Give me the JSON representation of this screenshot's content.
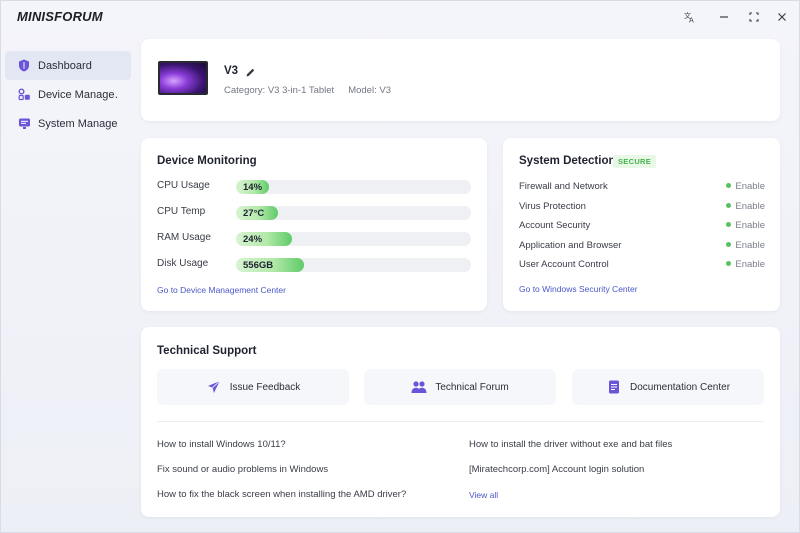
{
  "app": {
    "logo": "MINISFORUM"
  },
  "sidebar": {
    "items": [
      {
        "label": "Dashboard",
        "icon": "shield-icon",
        "active": true
      },
      {
        "label": "Device Manage…",
        "icon": "device-icon",
        "active": false
      },
      {
        "label": "System Manage…",
        "icon": "system-icon",
        "active": false
      }
    ]
  },
  "device": {
    "name": "V3",
    "category": "Category: V3 3-in-1 Tablet",
    "model": "Model: V3"
  },
  "monitoring": {
    "title": "Device Monitoring",
    "rows": [
      {
        "label": "CPU Usage",
        "value": "14%",
        "fill": 0.14
      },
      {
        "label": "CPU Temp",
        "value": "27°C",
        "fill": 0.18
      },
      {
        "label": "RAM Usage",
        "value": "24%",
        "fill": 0.24
      },
      {
        "label": "Disk Usage",
        "value": "556GB",
        "fill": 0.29
      }
    ],
    "link": "Go to Device Management Center"
  },
  "detection": {
    "title": "System Detection",
    "badge": "SECURE",
    "rows": [
      {
        "name": "Firewall and Network",
        "status": "Enable"
      },
      {
        "name": "Virus Protection",
        "status": "Enable"
      },
      {
        "name": "Account Security",
        "status": "Enable"
      },
      {
        "name": "Application and Browser",
        "status": "Enable"
      },
      {
        "name": "User Account Control",
        "status": "Enable"
      }
    ],
    "link": "Go to Windows Security Center"
  },
  "support": {
    "title": "Technical Support",
    "buttons": [
      {
        "label": "Issue Feedback",
        "icon": "paper-plane-icon"
      },
      {
        "label": "Technical Forum",
        "icon": "users-icon"
      },
      {
        "label": "Documentation Center",
        "icon": "document-icon"
      }
    ],
    "faq_left": [
      "How to install Windows 10/11?",
      "Fix sound or audio problems in Windows",
      "How to fix the black screen when installing the AMD driver?"
    ],
    "faq_right": [
      "How to install the driver without exe and bat files",
      "[Miratechcorp.com] Account login solution"
    ],
    "view_all": "View all"
  },
  "colors": {
    "accent": "#4b58c9",
    "success": "#57c25f",
    "icon_purple": "#6a55d8"
  }
}
